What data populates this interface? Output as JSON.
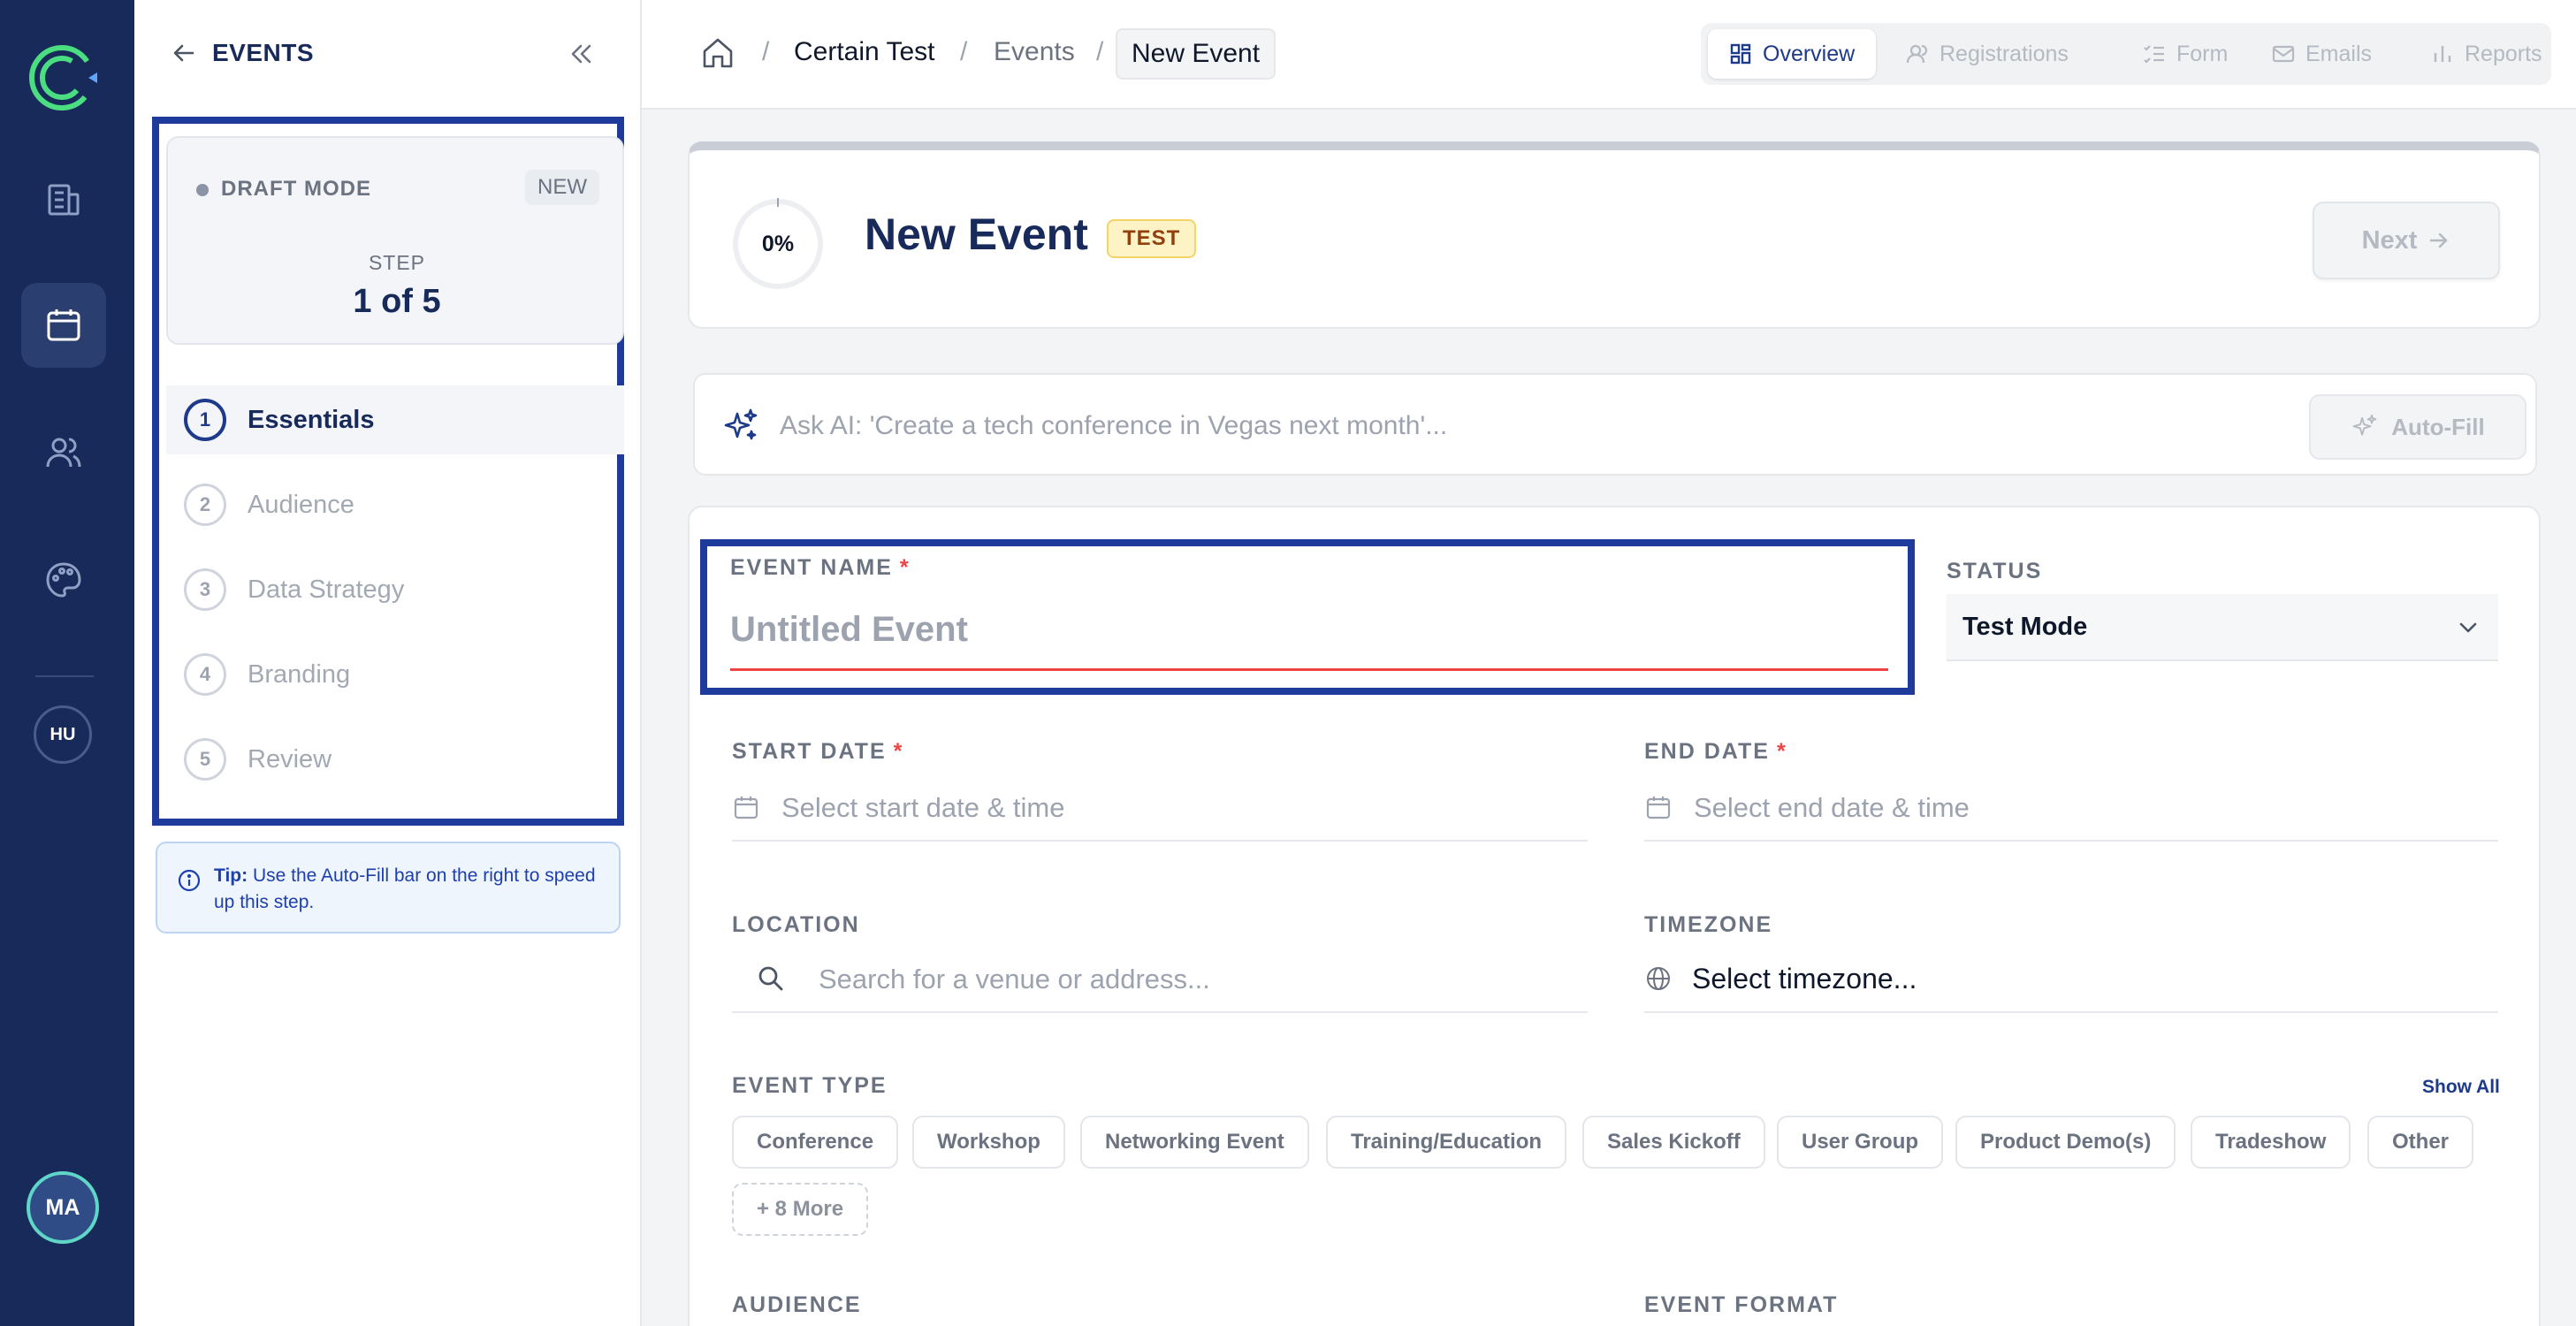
{
  "sidebar": {
    "title": "EVENTS",
    "draft": {
      "mode_label": "DRAFT MODE",
      "badge": "NEW",
      "step_label": "STEP",
      "step_value": "1 of 5"
    },
    "steps": [
      {
        "num": "1",
        "label": "Essentials"
      },
      {
        "num": "2",
        "label": "Audience"
      },
      {
        "num": "3",
        "label": "Data Strategy"
      },
      {
        "num": "4",
        "label": "Branding"
      },
      {
        "num": "5",
        "label": "Review"
      }
    ],
    "tip": {
      "bold": "Tip:",
      "text": " Use the Auto-Fill bar on the right to speed up this step."
    }
  },
  "rail": {
    "avatar_hu": "HU",
    "avatar_ma": "MA"
  },
  "breadcrumb": {
    "org": "Certain Test",
    "section": "Events",
    "current": "New Event"
  },
  "view_tabs": [
    "Overview",
    "Registrations",
    "Form",
    "Emails",
    "Reports"
  ],
  "header": {
    "progress": "0%",
    "title": "New Event",
    "badge": "TEST",
    "next_label": "Next"
  },
  "ai": {
    "placeholder": "Ask AI: 'Create a tech conference in Vegas next month'...",
    "autofill_label": "Auto-Fill"
  },
  "form": {
    "event_name": {
      "label": "EVENT NAME",
      "required": "*",
      "placeholder": "Untitled Event"
    },
    "status": {
      "label": "STATUS",
      "value": "Test Mode"
    },
    "start_date": {
      "label": "START DATE",
      "required": "*",
      "placeholder": "Select start date & time"
    },
    "end_date": {
      "label": "END DATE",
      "required": "*",
      "placeholder": "Select end date & time"
    },
    "location": {
      "label": "LOCATION",
      "placeholder": "Search for a venue or address..."
    },
    "timezone": {
      "label": "TIMEZONE",
      "value": "Select timezone..."
    },
    "event_type": {
      "label": "EVENT TYPE",
      "show_all": "Show All",
      "chips": [
        "Conference",
        "Workshop",
        "Networking Event",
        "Training/Education",
        "Sales Kickoff",
        "User Group",
        "Product Demo(s)",
        "Tradeshow",
        "Other"
      ],
      "more": "+ 8 More"
    },
    "audience": {
      "label": "AUDIENCE"
    },
    "event_format": {
      "label": "EVENT FORMAT"
    }
  },
  "colors": {
    "rail": "#172a5a",
    "accent": "#1e3a8a",
    "highlight_frame": "#1e3a9a",
    "required": "#ef4444"
  }
}
